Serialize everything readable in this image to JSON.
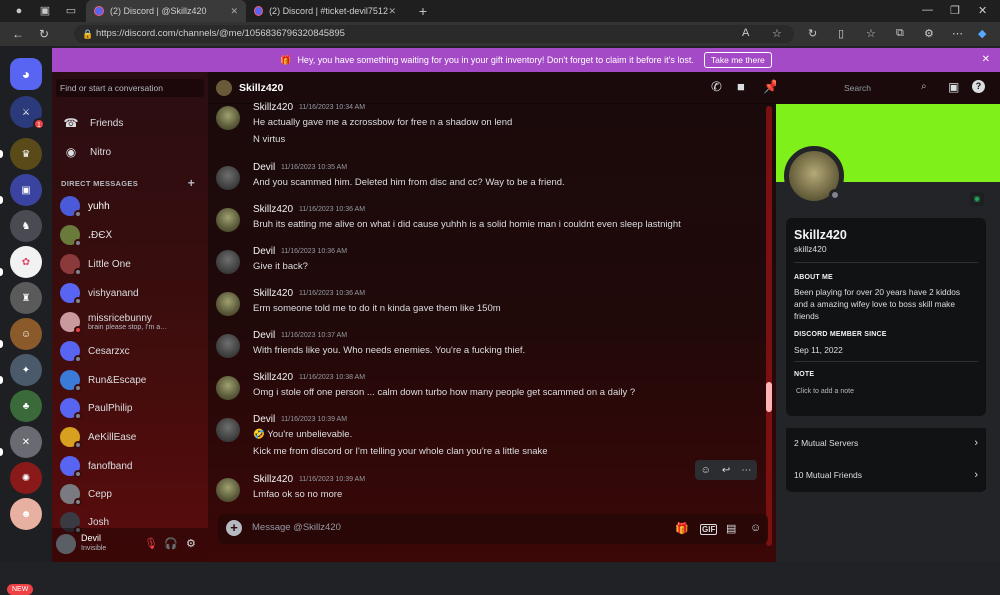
{
  "browser": {
    "tabs": [
      {
        "title": "(2) Discord | @Skillz420"
      },
      {
        "title": "(2) Discord | #ticket-devil7512 | …"
      }
    ],
    "url": "https://discord.com/channels/@me/1056836796320845895"
  },
  "banner": {
    "message": "Hey, you have something waiting for you in your gift inventory! Don't forget to claim it before it's lost.",
    "cta": "Take me there"
  },
  "servers": {
    "badge_count": "1",
    "new_label": "NEW"
  },
  "dm": {
    "search_placeholder": "Find or start a conversation",
    "nav": {
      "friends": "Friends",
      "nitro": "Nitro"
    },
    "header": "DIRECT MESSAGES",
    "items": [
      {
        "name": "yuhh"
      },
      {
        "name": "ꓸĐЄꓫ"
      },
      {
        "name": "Little One"
      },
      {
        "name": "vishyanand"
      },
      {
        "name": "missricebunny",
        "sub": "brain please stop, I'm a…"
      },
      {
        "name": "Cesarzxc"
      },
      {
        "name": "Run&Escape"
      },
      {
        "name": "PaulPhilip"
      },
      {
        "name": "AeKillEase"
      },
      {
        "name": "fanofband"
      },
      {
        "name": "Cepp"
      },
      {
        "name": "Josh"
      }
    ],
    "user": {
      "name": "Devil",
      "status": "Invisible"
    }
  },
  "chat": {
    "title": "Skillz420",
    "search_placeholder": "Search",
    "composer_placeholder": "Message @Skillz420",
    "messages": [
      {
        "author": "Skillz420",
        "time": "11/16/2023 10:34 AM",
        "lines": [
          "He actually gave me a zcrossbow for free n a shadow on lend",
          "N virtus"
        ]
      },
      {
        "author": "Devil",
        "time": "11/16/2023 10:35 AM",
        "lines": [
          "And you scammed him. Deleted him from disc and cc? Way to be a friend."
        ]
      },
      {
        "author": "Skillz420",
        "time": "11/16/2023 10:36 AM",
        "lines": [
          "Bruh its eatting me alive on what i did cause yuhhh is a solid homie man i couldnt even sleep lastnight"
        ]
      },
      {
        "author": "Devil",
        "time": "11/16/2023 10:36 AM",
        "lines": [
          "Give it back?"
        ]
      },
      {
        "author": "Skillz420",
        "time": "11/16/2023 10:36 AM",
        "lines": [
          "Erm someone told me to do it n kinda gave them like 150m"
        ]
      },
      {
        "author": "Devil",
        "time": "11/16/2023 10:37 AM",
        "lines": [
          "With friends like you. Who needs enemies. You're a fucking thief."
        ]
      },
      {
        "author": "Skillz420",
        "time": "11/16/2023 10:38 AM",
        "lines": [
          "Omg i stole off one person ... calm down turbo how many people get scammed on a daily ?"
        ]
      },
      {
        "author": "Devil",
        "time": "11/16/2023 10:39 AM",
        "lines": [
          "🤣 You're unbelievable.",
          "Kick me from discord or I'm telling your whole clan you're a little snake"
        ]
      },
      {
        "author": "Skillz420",
        "time": "11/16/2023 10:39 AM",
        "lines": [
          "Lmfao ok so no more"
        ]
      }
    ]
  },
  "profile": {
    "display_name": "Skillz420",
    "username": "skillz420",
    "about_header": "ABOUT ME",
    "about": "Been playing for over 20 years have 2 kiddos and a amazing wifey love to boss skill make friends",
    "member_since_header": "DISCORD MEMBER SINCE",
    "member_since": "Sep 11, 2022",
    "note_header": "NOTE",
    "note_placeholder": "Click to add a note",
    "mutual_servers": "2 Mutual Servers",
    "mutual_friends": "10 Mutual Friends",
    "banner_color": "#80f01a"
  }
}
